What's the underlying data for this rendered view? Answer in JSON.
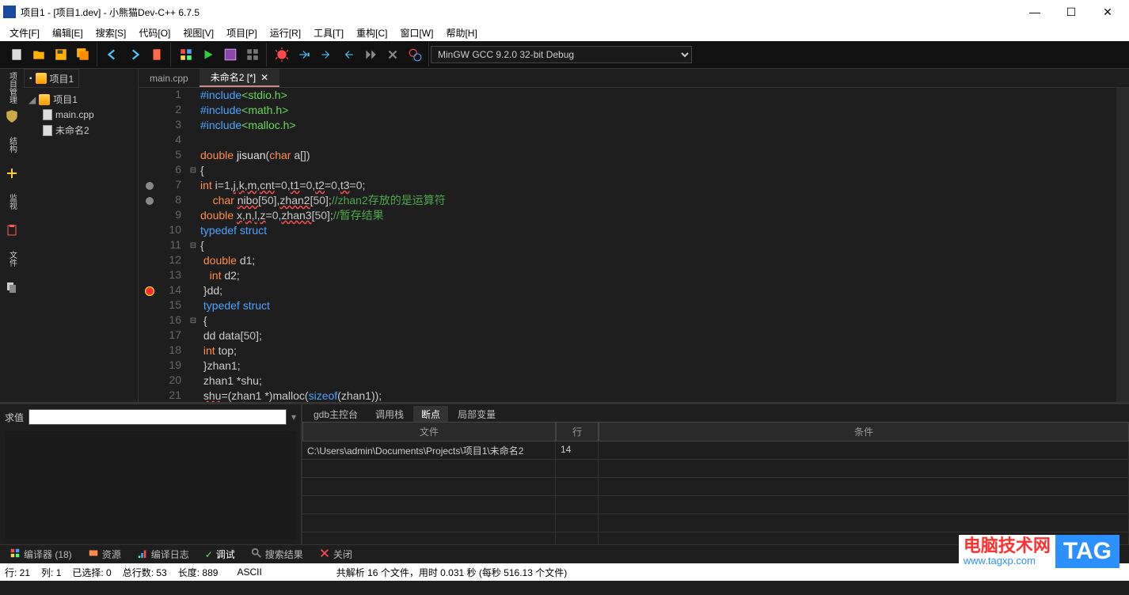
{
  "window": {
    "title": "项目1 - [项目1.dev] - 小熊猫Dev-C++ 6.7.5"
  },
  "menus": [
    "文件[F]",
    "编辑[E]",
    "搜索[S]",
    "代码[O]",
    "视图[V]",
    "项目[P]",
    "运行[R]",
    "工具[T]",
    "重构[C]",
    "窗口[W]",
    "帮助[H]"
  ],
  "compiler_select": "MinGW GCC 9.2.0 32-bit Debug",
  "side_tabs": [
    "项目管理",
    "结构",
    "监视",
    "文件"
  ],
  "project_tab": "项目1",
  "tree": {
    "root": "项目1",
    "items": [
      "main.cpp",
      "未命名2"
    ]
  },
  "editor_tabs": [
    {
      "label": "main.cpp",
      "active": false
    },
    {
      "label": "未命名2 [*]",
      "active": true
    }
  ],
  "code": {
    "lines": [
      {
        "n": 1,
        "html": "<span class='k'>#include</span><span class='s'>&lt;stdio.h&gt;</span>"
      },
      {
        "n": 2,
        "html": "<span class='k'>#include</span><span class='s'>&lt;math.h&gt;</span>"
      },
      {
        "n": 3,
        "html": "<span class='k'>#include</span><span class='s'>&lt;malloc.h&gt;</span>"
      },
      {
        "n": 4,
        "html": ""
      },
      {
        "n": 5,
        "html": "<span class='t'>double</span> <span class='fn'>jisuan</span>(<span class='t'>char</span> a[])"
      },
      {
        "n": 6,
        "fold": "⊟",
        "html": "{"
      },
      {
        "n": 7,
        "bp": "grey",
        "html": "<span class='t'>int</span> i=<span class='num'>1</span>,<span class='under'>j</span>,<span class='under'>k</span>,<span class='under'>m</span>,<span class='under'>cnt</span>=<span class='num'>0</span>,<span class='under'>t1</span>=<span class='num'>0</span>,<span class='under'>t2</span>=<span class='num'>0</span>,<span class='under'>t3</span>=<span class='num'>0</span>;"
      },
      {
        "n": 8,
        "bp": "grey",
        "html": "    <span class='t'>char</span> <span class='under'>nibo</span>[<span class='num'>50</span>],<span class='under'>zhan2</span>[<span class='num'>50</span>];<span class='c'>//zhan2存放的是运算符</span>"
      },
      {
        "n": 9,
        "html": "<span class='t'>double</span> <span class='under'>x</span>,<span class='under'>n</span>,<span class='under'>l</span>,<span class='under'>z</span>=<span class='num'>0</span>,<span class='under'>zhan3</span>[<span class='num'>50</span>];<span class='c'>//暂存结果</span>"
      },
      {
        "n": 10,
        "html": "<span class='k'>typedef</span> <span class='k'>struct</span>"
      },
      {
        "n": 11,
        "fold": "⊟",
        "html": "{"
      },
      {
        "n": 12,
        "html": " <span class='t'>double</span> d1;"
      },
      {
        "n": 13,
        "html": "   <span class='t'>int</span> d2;"
      },
      {
        "n": 14,
        "bp": "active",
        "html": " }dd;"
      },
      {
        "n": 15,
        "html": " <span class='k'>typedef</span> <span class='k'>struct</span>"
      },
      {
        "n": 16,
        "fold": "⊟",
        "html": " {"
      },
      {
        "n": 17,
        "html": " dd data[<span class='num'>50</span>];"
      },
      {
        "n": 18,
        "html": " <span class='t'>int</span> top;"
      },
      {
        "n": 19,
        "html": " }zhan1;"
      },
      {
        "n": 20,
        "html": " zhan1 *shu;"
      },
      {
        "n": 21,
        "html": " <span class='under'>shu</span>=(zhan1 *)malloc(<span class='k'>sizeof</span>(zhan1));"
      }
    ]
  },
  "eval": {
    "label": "求值",
    "value": ""
  },
  "debug_tabs": [
    "gdb主控台",
    "调用栈",
    "断点",
    "局部变量"
  ],
  "debug_active_tab": "断点",
  "bp_table": {
    "headers": {
      "file": "文件",
      "line": "行",
      "cond": "条件"
    },
    "rows": [
      {
        "file": "C:\\Users\\admin\\Documents\\Projects\\项目1\\未命名2",
        "line": "14",
        "cond": ""
      }
    ]
  },
  "bottom_tabs": [
    {
      "ico": "blocks",
      "label": "编译器 (18)"
    },
    {
      "ico": "res",
      "label": "资源"
    },
    {
      "ico": "log",
      "label": "编译日志"
    },
    {
      "ico": "debug",
      "label": "调试",
      "active": true,
      "check": true
    },
    {
      "ico": "search",
      "label": "搜索结果"
    },
    {
      "ico": "close",
      "label": "关闭"
    }
  ],
  "status": {
    "seg1": "行:   21",
    "seg2": "列:   1",
    "seg3": "已选择:   0",
    "seg4": "总行数:   53",
    "seg5": "长度:   889",
    "seg6": "ASCII",
    "seg7": "共解析 16 个文件，用时 0.031 秒 (每秒 516.13 个文件)"
  },
  "watermark": {
    "line1": "电脑技术网",
    "line2": "www.tagxp.com",
    "tag": "TAG"
  }
}
